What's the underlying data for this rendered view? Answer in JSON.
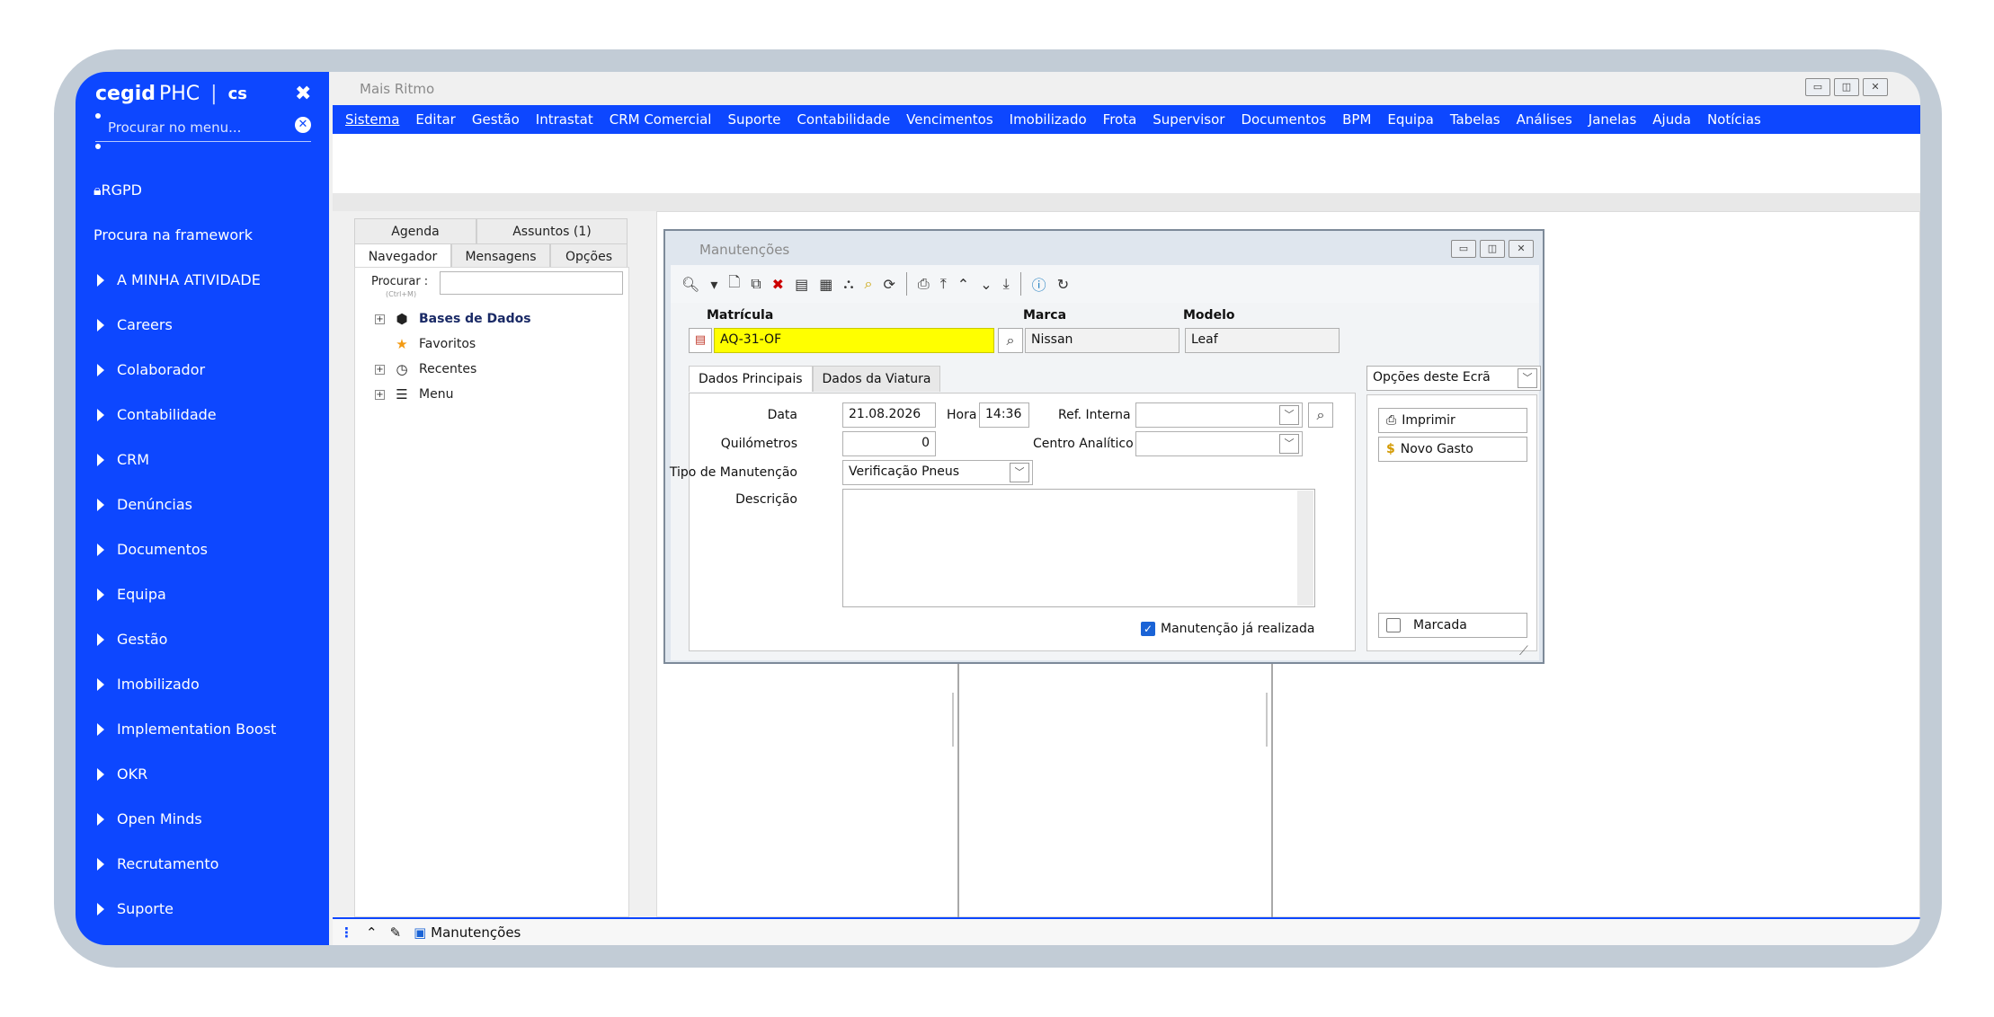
{
  "sidebar": {
    "brand": "cegid",
    "product": "PHC",
    "divider": "|",
    "edition": "cs",
    "search_placeholder": "Procurar no menu...",
    "rgpd": "RGPD",
    "framework": "Procura na framework",
    "items": [
      "A MINHA ATIVIDADE",
      "Careers",
      "Colaborador",
      "Contabilidade",
      "CRM",
      "Denúncias",
      "Documentos",
      "Equipa",
      "Gestão",
      "Imobilizado",
      "Implementation Boost",
      "OKR",
      "Open Minds",
      "Recrutamento",
      "Suporte"
    ]
  },
  "window": {
    "title": "Mais Ritmo"
  },
  "menubar": [
    "Sistema",
    "Editar",
    "Gestão",
    "Intrastat",
    "CRM Comercial",
    "Suporte",
    "Contabilidade",
    "Vencimentos",
    "Imobilizado",
    "Frota",
    "Supervisor",
    "Documentos",
    "BPM",
    "Equipa",
    "Tabelas",
    "Análises",
    "Janelas",
    "Ajuda",
    "Notícias"
  ],
  "navigator": {
    "tabs_top": [
      "Agenda",
      "Assuntos (1)"
    ],
    "tabs_bottom": [
      "Navegador",
      "Mensagens",
      "Opções"
    ],
    "search_label": "Procurar :",
    "search_shortcut": "(Ctrl+M)",
    "tree": [
      "Bases de Dados",
      "Favoritos",
      "Recentes",
      "Menu"
    ]
  },
  "dialog": {
    "title": "Manutenções",
    "matricula_label": "Matrícula",
    "matricula_value": "AQ-31-OF",
    "marca_label": "Marca",
    "marca_value": "Nissan",
    "modelo_label": "Modelo",
    "modelo_value": "Leaf",
    "tabs": [
      "Dados Principais",
      "Dados da Viatura"
    ],
    "data_label": "Data",
    "data_value": "21.08.2026",
    "hora_label": "Hora",
    "hora_value": "14:36",
    "ref_label": "Ref. Interna",
    "ref_value": "",
    "km_label": "Quilómetros",
    "km_value": "0",
    "centro_label": "Centro Analítico",
    "centro_value": "",
    "tipo_label": "Tipo de Manutenção",
    "tipo_value": "Verificação Pneus",
    "descricao_label": "Descrição",
    "descricao_value": "",
    "realizada_label": "Manutenção já realizada",
    "realizada_checked": true,
    "opcoes_label": "Opções deste Ecrã",
    "imprimir_label": "Imprimir",
    "novo_gasto_label": "Novo Gasto",
    "marcada_label": "Marcada",
    "marcada_checked": false
  },
  "taskbar": {
    "item": "Manutenções"
  },
  "colors": {
    "accent": "#0d47ff",
    "highlight": "#ffff00"
  }
}
